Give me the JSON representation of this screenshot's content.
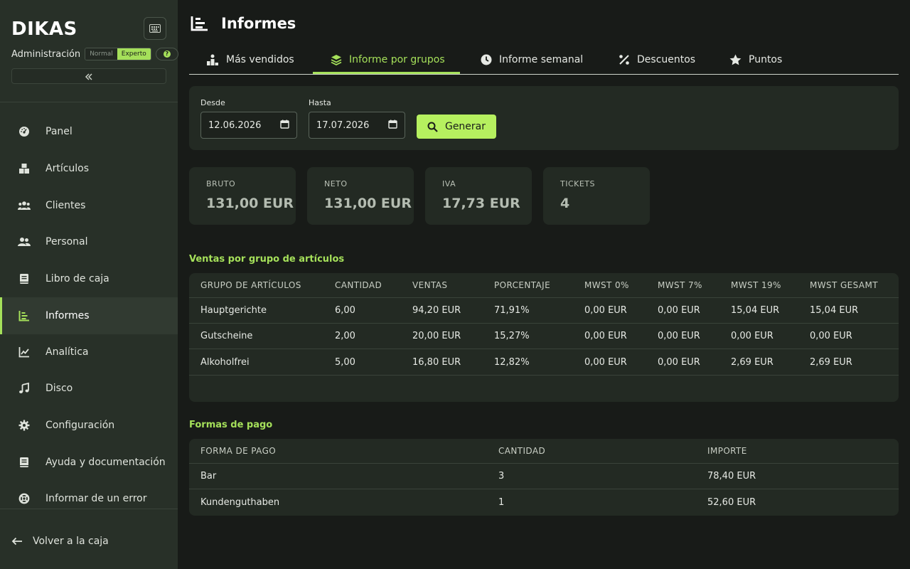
{
  "app": {
    "logo": "DIKAS"
  },
  "sidebar": {
    "admin_label": "Administración",
    "mode_normal": "Normal",
    "mode_expert": "Experto",
    "items": [
      {
        "label": "Panel",
        "icon": "dashboard-gauge-icon"
      },
      {
        "label": "Artículos",
        "icon": "boxes-icon"
      },
      {
        "label": "Clientes",
        "icon": "users-group-icon"
      },
      {
        "label": "Personal",
        "icon": "user-pair-icon"
      },
      {
        "label": "Libro de caja",
        "icon": "book-icon"
      },
      {
        "label": "Informes",
        "icon": "report-list-icon",
        "active": true
      },
      {
        "label": "Analítica",
        "icon": "line-chart-icon"
      },
      {
        "label": "Disco",
        "icon": "music-note-icon"
      },
      {
        "label": "Configuración",
        "icon": "gear-icon"
      },
      {
        "label": "Ayuda y documentación",
        "icon": "book-icon"
      },
      {
        "label": "Informar de un error",
        "icon": "lifebuoy-icon"
      }
    ],
    "back_label": "Volver a la caja"
  },
  "header": {
    "title": "Informes"
  },
  "tabs": [
    {
      "label": "Más vendidos",
      "icon": "podium-icon"
    },
    {
      "label": "Informe por grupos",
      "icon": "layers-icon",
      "active": true
    },
    {
      "label": "Informe semanal",
      "icon": "clock-icon"
    },
    {
      "label": "Descuentos",
      "icon": "percent-icon"
    },
    {
      "label": "Puntos",
      "icon": "star-icon"
    }
  ],
  "filters": {
    "from_label": "Desde",
    "from_value": "12.06.2026",
    "to_label": "Hasta",
    "to_value": "17.07.2026",
    "generate_label": "Generar"
  },
  "stats": [
    {
      "label": "BRUTO",
      "value": "131,00 EUR"
    },
    {
      "label": "NETO",
      "value": "131,00 EUR"
    },
    {
      "label": "IVA",
      "value": "17,73 EUR"
    },
    {
      "label": "TICKETS",
      "value": "4"
    }
  ],
  "groups_table": {
    "title": "Ventas por grupo de artículos",
    "columns": [
      "GRUPO DE ARTÍCULOS",
      "CANTIDAD",
      "VENTAS",
      "PORCENTAJE",
      "MWST 0%",
      "MWST 7%",
      "MWST 19%",
      "MWST GESAMT"
    ],
    "rows": [
      [
        "Hauptgerichte",
        "6,00",
        "94,20 EUR",
        "71,91%",
        "0,00 EUR",
        "0,00 EUR",
        "15,04 EUR",
        "15,04 EUR"
      ],
      [
        "Gutscheine",
        "2,00",
        "20,00 EUR",
        "15,27%",
        "0,00 EUR",
        "0,00 EUR",
        "0,00 EUR",
        "0,00 EUR"
      ],
      [
        "Alkoholfrei",
        "5,00",
        "16,80 EUR",
        "12,82%",
        "0,00 EUR",
        "0,00 EUR",
        "2,69 EUR",
        "2,69 EUR"
      ]
    ]
  },
  "payments_table": {
    "title": "Formas de pago",
    "columns": [
      "FORMA DE PAGO",
      "CANTIDAD",
      "IMPORTE"
    ],
    "rows": [
      [
        "Bar",
        "3",
        "78,40 EUR"
      ],
      [
        "Kundenguthaben",
        "1",
        "52,60 EUR"
      ]
    ]
  },
  "colors": {
    "accent": "#a5e05a",
    "sidebar_bg": "#283028",
    "page_bg": "#181b18",
    "card_bg": "#232a23"
  }
}
